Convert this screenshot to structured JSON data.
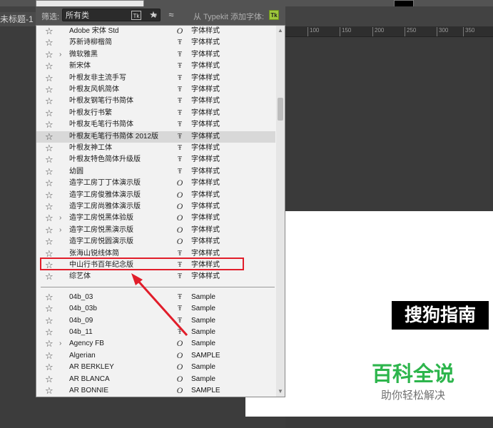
{
  "app": {
    "document_tab": "未标题-1 @"
  },
  "filter": {
    "label": "筛选:",
    "value": "所有类",
    "typekit_label": "从 Typekit 添加字体:",
    "tk_button": "Tk",
    "typekit_logo": "Tk"
  },
  "ruler": {
    "ticks": [
      "100",
      "150",
      "200",
      "250",
      "300",
      "350"
    ]
  },
  "fonts": [
    {
      "name": "Adobe 宋体 Std",
      "type": "O",
      "preview": "字体样式",
      "sub": false
    },
    {
      "name": "苏新诗柳楷简",
      "type": "T",
      "preview": "字体样式",
      "sub": false
    },
    {
      "name": "微软雅黑",
      "type": "T",
      "preview": "字体样式",
      "sub": true
    },
    {
      "name": "新宋体",
      "type": "T",
      "preview": "字体样式",
      "sub": false
    },
    {
      "name": "叶根友非主流手写",
      "type": "T",
      "preview": "字体样式",
      "sub": false
    },
    {
      "name": "叶根友风帆简体",
      "type": "T",
      "preview": "字体样式",
      "sub": false
    },
    {
      "name": "叶根友钢笔行书简体",
      "type": "T",
      "preview": "字体样式",
      "sub": false
    },
    {
      "name": "叶根友行书繁",
      "type": "T",
      "preview": "字体样式",
      "sub": false
    },
    {
      "name": "叶根友毛笔行书简体",
      "type": "T",
      "preview": "字体样式",
      "sub": false
    },
    {
      "name": "叶根友毛笔行书简体 2012版",
      "type": "T",
      "preview": "字体样式",
      "sub": false,
      "highlighted": true
    },
    {
      "name": "叶根友神工体",
      "type": "T",
      "preview": "字体样式",
      "sub": false
    },
    {
      "name": "叶根友特色简体升级版",
      "type": "T",
      "preview": "字体样式",
      "sub": false
    },
    {
      "name": "幼圆",
      "type": "T",
      "preview": "字体样式",
      "sub": false
    },
    {
      "name": "造字工房丁丁体演示版",
      "type": "O",
      "preview": "字体样式",
      "sub": false
    },
    {
      "name": "造字工房俊雅体演示版",
      "type": "O",
      "preview": "字体样式",
      "sub": false
    },
    {
      "name": "造字工房尚雅体演示版",
      "type": "O",
      "preview": "字体样式",
      "sub": false
    },
    {
      "name": "造字工房悦黑体验版",
      "type": "O",
      "preview": "字体样式",
      "sub": true
    },
    {
      "name": "造字工房悦黑演示版",
      "type": "O",
      "preview": "字体样式",
      "sub": true
    },
    {
      "name": "造字工房悦圆演示版",
      "type": "O",
      "preview": "字体样式",
      "sub": false
    },
    {
      "name": "张海山锐线体简",
      "type": "T",
      "preview": "字体样式",
      "sub": false
    },
    {
      "name": "中山行书百年纪念版",
      "type": "T",
      "preview": "字体样式",
      "sub": false
    },
    {
      "name": "综艺体",
      "type": "T",
      "preview": "字体样式",
      "sub": false
    }
  ],
  "latin_fonts": [
    {
      "name": "04b_03",
      "type": "T",
      "preview": "Sample",
      "sub": false
    },
    {
      "name": "04b_03b",
      "type": "T",
      "preview": "Sample",
      "sub": false
    },
    {
      "name": "04b_09",
      "type": "T",
      "preview": "Sample",
      "sub": false
    },
    {
      "name": "04b_11",
      "type": "T",
      "preview": "Sample",
      "sub": false
    },
    {
      "name": "Agency FB",
      "type": "O",
      "preview": "Sample",
      "sub": true
    },
    {
      "name": "Algerian",
      "type": "O",
      "preview": "SAMPLE",
      "sub": false
    },
    {
      "name": "AR BERKLEY",
      "type": "O",
      "preview": "Sample",
      "sub": false
    },
    {
      "name": "AR BLANCA",
      "type": "O",
      "preview": "Sample",
      "sub": false
    },
    {
      "name": "AR BONNIE",
      "type": "O",
      "preview": "SAMPLE",
      "sub": false
    }
  ],
  "watermark": {
    "black_text": "搜狗指南",
    "green_text": "百科全说",
    "sub_text": "助你轻松解决"
  }
}
